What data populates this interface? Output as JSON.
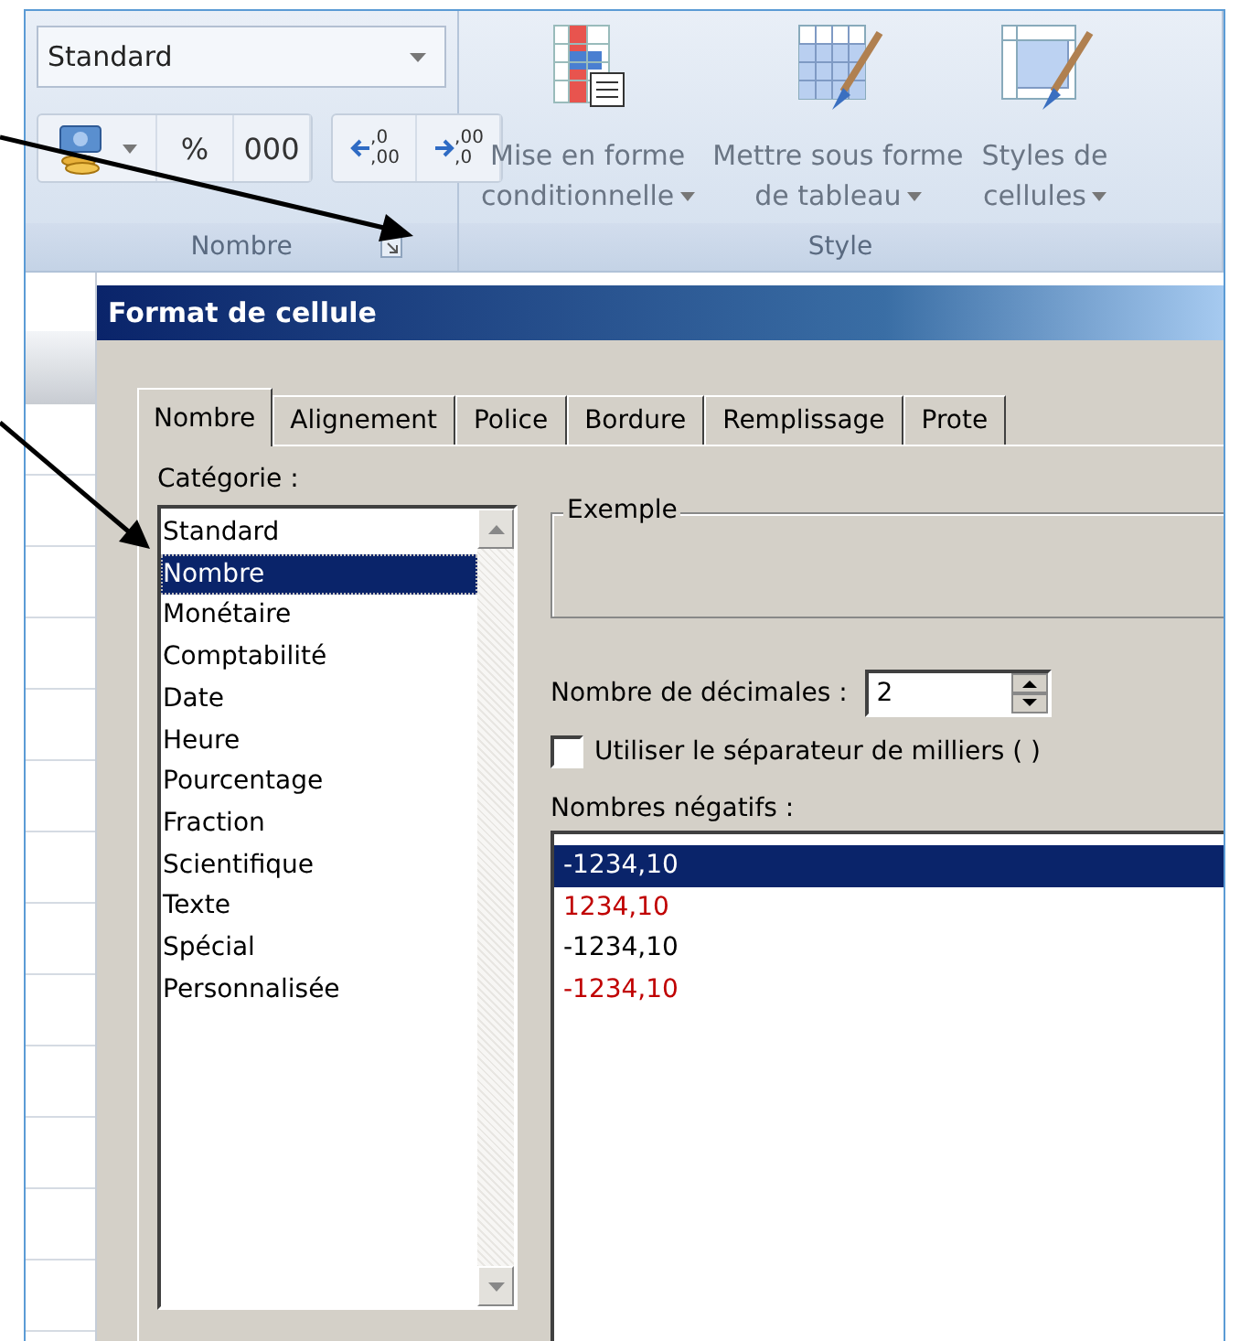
{
  "ribbon": {
    "number_group": {
      "format_dropdown": "Standard",
      "percent": "%",
      "thousands": "000",
      "increase_decimal": {
        "top": ",0",
        "bottom": ",00"
      },
      "decrease_decimal": {
        "top": ",00",
        "bottom": ",0"
      },
      "label": "Nombre"
    },
    "style_group": {
      "buttons": [
        {
          "kind": "conditional",
          "lines": [
            "Mise en forme",
            "conditionnelle"
          ]
        },
        {
          "kind": "table",
          "lines": [
            "Mettre sous forme",
            "de tableau"
          ]
        },
        {
          "kind": "cellstyles",
          "lines": [
            "Styles de",
            "cellules"
          ]
        }
      ],
      "label": "Style"
    }
  },
  "dialog": {
    "title": "Format de cellule",
    "tabs": [
      {
        "label": "Nombre",
        "selected": true
      },
      {
        "label": "Alignement",
        "selected": false
      },
      {
        "label": "Police",
        "selected": false
      },
      {
        "label": "Bordure",
        "selected": false
      },
      {
        "label": "Remplissage",
        "selected": false
      },
      {
        "label": "Prote",
        "selected": false
      }
    ],
    "category_label": "Catégorie :",
    "categories": [
      {
        "label": "Standard",
        "selected": false
      },
      {
        "label": "Nombre",
        "selected": true
      },
      {
        "label": "Monétaire",
        "selected": false
      },
      {
        "label": "Comptabilité",
        "selected": false
      },
      {
        "label": "Date",
        "selected": false
      },
      {
        "label": "Heure",
        "selected": false
      },
      {
        "label": "Pourcentage",
        "selected": false
      },
      {
        "label": "Fraction",
        "selected": false
      },
      {
        "label": "Scientifique",
        "selected": false
      },
      {
        "label": "Texte",
        "selected": false
      },
      {
        "label": "Spécial",
        "selected": false
      },
      {
        "label": "Personnalisée",
        "selected": false
      }
    ],
    "example_label": "Exemple",
    "decimals_label": "Nombre de décimales :",
    "decimals_value": "2",
    "thousands_separator": {
      "label": "Utiliser le séparateur de milliers ( )",
      "checked": false
    },
    "negatives_label": "Nombres négatifs :",
    "negatives": [
      {
        "text": "-1234,10",
        "selected": true
      },
      {
        "text": "1234,10",
        "color": "#c00000",
        "selected": false
      },
      {
        "text": "-1234,10",
        "color": "#000000",
        "selected": false
      },
      {
        "text": "-1234,10",
        "color": "#c00000",
        "selected": false
      }
    ]
  }
}
